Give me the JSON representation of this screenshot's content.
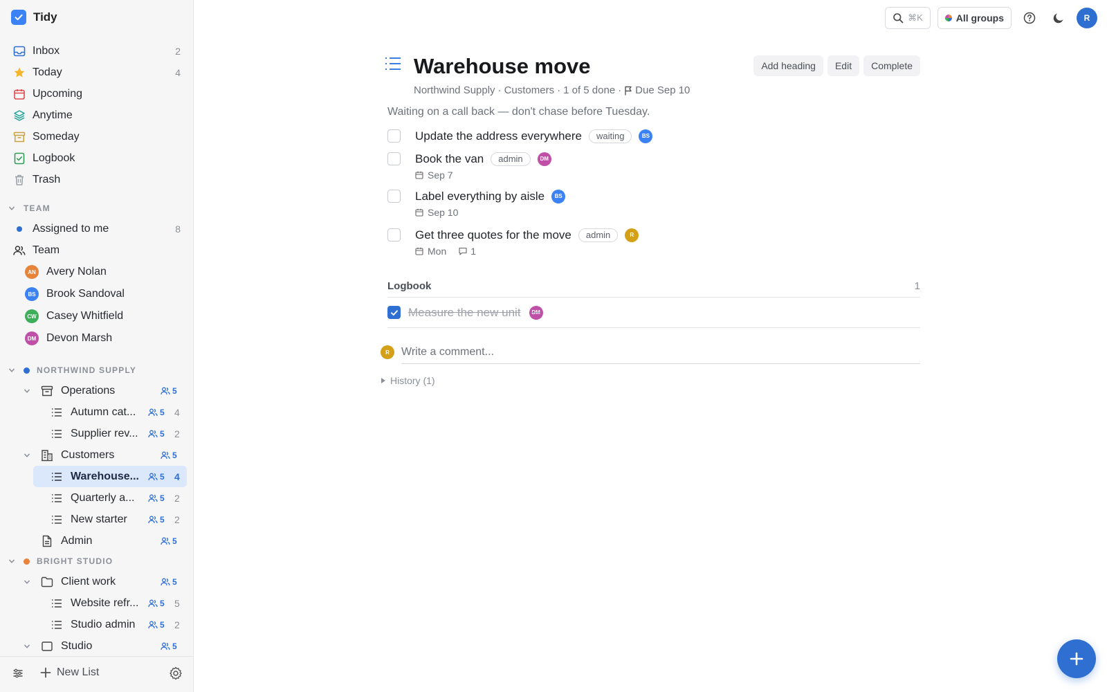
{
  "app": {
    "name": "Tidy"
  },
  "sidebar": {
    "nav": [
      {
        "label": "Inbox",
        "count": "2",
        "icon": "inbox-icon"
      },
      {
        "label": "Today",
        "count": "4",
        "icon": "star-icon"
      },
      {
        "label": "Upcoming",
        "count": "",
        "icon": "calendar-icon"
      },
      {
        "label": "Anytime",
        "count": "",
        "icon": "layers-icon"
      },
      {
        "label": "Someday",
        "count": "",
        "icon": "archive-box-icon"
      },
      {
        "label": "Logbook",
        "count": "",
        "icon": "logbook-icon"
      },
      {
        "label": "Trash",
        "count": "",
        "icon": "trash-icon"
      }
    ],
    "team_section": {
      "heading": "TEAM",
      "assigned_label": "Assigned to me",
      "assigned_count": "8",
      "team_label": "Team",
      "members": [
        {
          "name": "Avery Nolan",
          "initials": "AN",
          "color": "#e8833a"
        },
        {
          "name": "Brook Sandoval",
          "initials": "BS",
          "color": "#3b82f6"
        },
        {
          "name": "Casey Whitfield",
          "initials": "CW",
          "color": "#3fae5a"
        },
        {
          "name": "Devon Marsh",
          "initials": "DM",
          "color": "#c04fa8"
        }
      ]
    },
    "workspaces": [
      {
        "name": "NORTHWIND SUPPLY",
        "color": "#2e6fd1",
        "items": [
          {
            "label": "Operations",
            "share": "5",
            "count": ""
          },
          {
            "label": "Autumn cat...",
            "share": "5",
            "count": "4"
          },
          {
            "label": "Supplier rev...",
            "share": "5",
            "count": "2"
          },
          {
            "label": "Customers",
            "share": "5",
            "count": ""
          },
          {
            "label": "Warehouse...",
            "share": "5",
            "count": "4"
          },
          {
            "label": "Quarterly a...",
            "share": "5",
            "count": "2"
          },
          {
            "label": "New starter",
            "share": "5",
            "count": "2"
          },
          {
            "label": "Admin",
            "share": "5",
            "count": ""
          }
        ]
      },
      {
        "name": "BRIGHT STUDIO",
        "color": "#e8833a",
        "items": [
          {
            "label": "Client work",
            "share": "5",
            "count": ""
          },
          {
            "label": "Website refr...",
            "share": "5",
            "count": "5"
          },
          {
            "label": "Studio admin",
            "share": "5",
            "count": "2"
          },
          {
            "label": "Studio",
            "share": "5",
            "count": ""
          }
        ]
      }
    ],
    "footer": {
      "new_list": "New List"
    }
  },
  "topbar": {
    "search_shortcut": "⌘K",
    "groups_label": "All groups",
    "user_initial": "R"
  },
  "list": {
    "title": "Warehouse move",
    "actions": {
      "add_heading": "Add heading",
      "edit": "Edit",
      "complete": "Complete"
    },
    "meta": {
      "workspace": "Northwind Supply",
      "parent": "Customers",
      "progress": "1 of 5 done",
      "due": "Due Sep 10"
    },
    "note": "Waiting on a call back — don't chase before Tuesday.",
    "tasks": [
      {
        "title": "Update the address everywhere",
        "tag": "waiting",
        "assignee": "BS",
        "assignee_color": "#3b82f6",
        "date": "",
        "comments": ""
      },
      {
        "title": "Book the van",
        "tag": "admin",
        "assignee": "DM",
        "assignee_color": "#c04fa8",
        "date": "Sep 7",
        "comments": ""
      },
      {
        "title": "Label everything by aisle",
        "tag": "",
        "assignee": "BS",
        "assignee_color": "#3b82f6",
        "date": "Sep 10",
        "comments": ""
      },
      {
        "title": "Get three quotes for the move",
        "tag": "admin",
        "assignee": "R",
        "assignee_color": "#d4a017",
        "date": "Mon",
        "comments": "1"
      }
    ],
    "logbook": {
      "heading": "Logbook",
      "count": "1",
      "tasks": [
        {
          "title": "Measure the new unit",
          "assignee": "DM",
          "assignee_color": "#c04fa8"
        }
      ]
    },
    "comment": {
      "avatar": "R",
      "avatar_color": "#d4a017",
      "placeholder": "Write a comment..."
    },
    "history_label": "History (1)"
  }
}
